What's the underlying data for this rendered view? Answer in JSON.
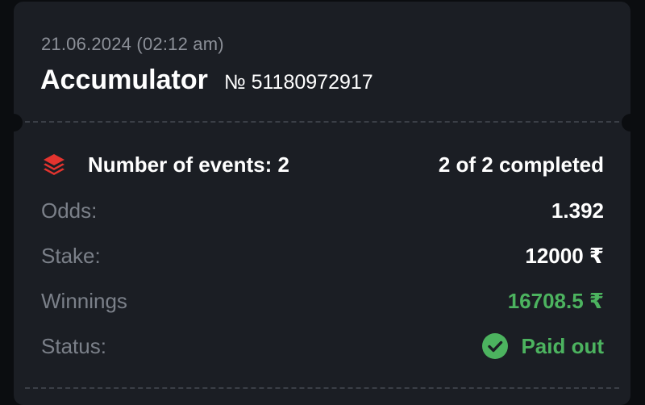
{
  "colors": {
    "accent_red": "#e3342f",
    "success_green": "#4cb35f",
    "card_background": "#1b1e24"
  },
  "bet": {
    "datetime": "21.06.2024 (02:12 am)",
    "title": "Accumulator",
    "number": "№ 51180972917"
  },
  "summary": {
    "events_label": "Number of events: 2",
    "events_icon": "layers-icon",
    "completed": "2 of 2 completed"
  },
  "details": {
    "odds_label": "Odds:",
    "odds_value": "1.392",
    "stake_label": "Stake:",
    "stake_value": "12000 ₹",
    "winnings_label": "Winnings",
    "winnings_value": "16708.5 ₹",
    "status_label": "Status:",
    "status_value": "Paid out",
    "status_icon": "check-circle-icon"
  }
}
